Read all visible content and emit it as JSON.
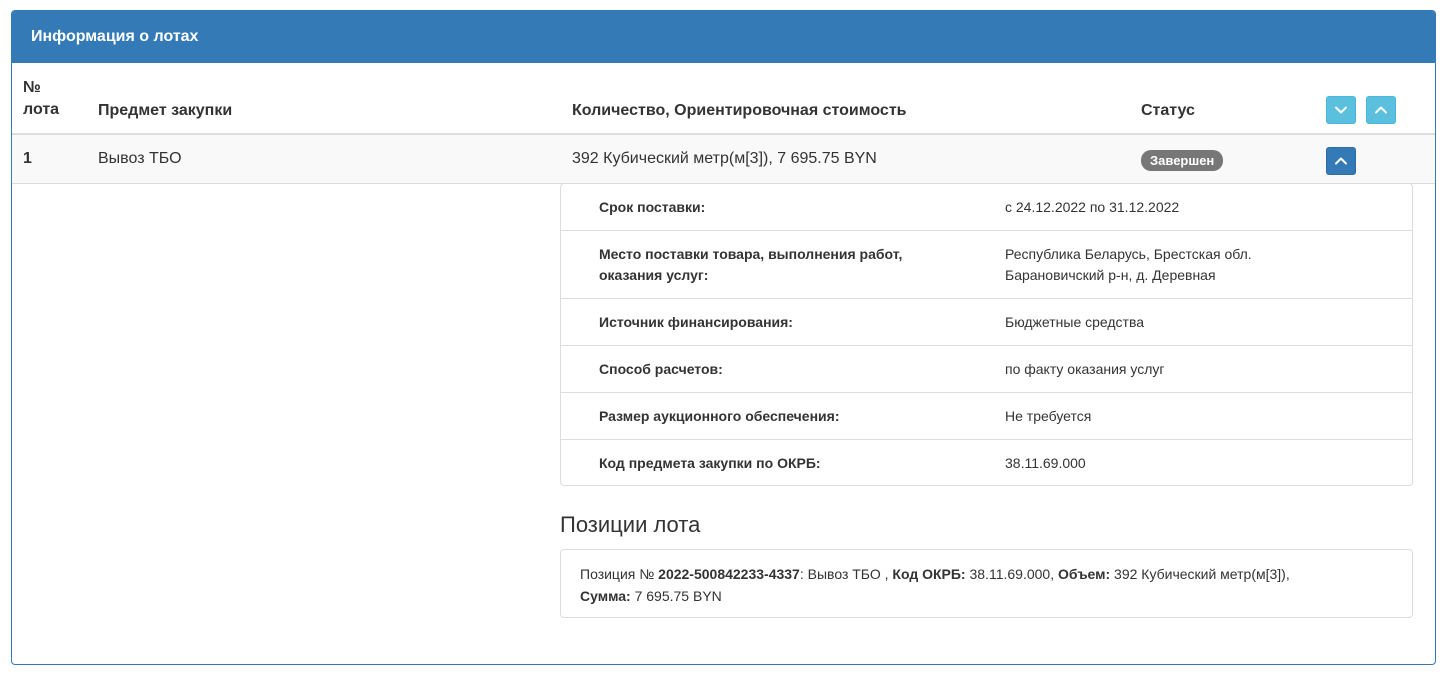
{
  "panel": {
    "title": "Информация о лотах"
  },
  "table": {
    "headers": {
      "num_line1": "№",
      "num_line2": "лота",
      "subject": "Предмет закупки",
      "quantity": "Количество, Ориентировочная стоимость",
      "status": "Статус"
    },
    "rows": [
      {
        "num": "1",
        "subject": "Вывоз ТБО",
        "quantity": "392 Кубический метр(м[3]), 7 695.75 BYN",
        "status": "Завершен"
      }
    ]
  },
  "details": [
    {
      "label": "Срок поставки:",
      "value": "с 24.12.2022 по 31.12.2022"
    },
    {
      "label": "Место поставки товара, выполнения работ, оказания услуг:",
      "value": "Республика Беларусь, Брестская обл. Барановичский р-н, д. Деревная"
    },
    {
      "label": "Источник финансирования:",
      "value": "Бюджетные средства"
    },
    {
      "label": "Способ расчетов:",
      "value": "по факту оказания услуг"
    },
    {
      "label": "Размер аукционного обеспечения:",
      "value": "Не требуется"
    },
    {
      "label": "Код предмета закупки по ОКРБ:",
      "value": "38.11.69.000"
    }
  ],
  "positions": {
    "title": "Позиции лота",
    "items": [
      {
        "prefix": "Позиция № ",
        "number": "2022-500842233-4337",
        "name": ": Вывоз ТБО , ",
        "okrb_label": "Код ОКРБ:",
        "okrb_value": " 38.11.69.000, ",
        "volume_label": "Объем:",
        "volume_value": " 392 Кубический метр(м[3]),",
        "sum_label": "Сумма:",
        "sum_value": " 7 695.75 BYN"
      }
    ]
  },
  "colors": {
    "primary": "#337ab7",
    "info": "#5bc0de",
    "badge": "#777777",
    "border": "#dddddd"
  },
  "icons": {
    "expand_all": "chevron-down-icon",
    "collapse_all": "chevron-up-icon",
    "row_toggle": "chevron-up-icon"
  }
}
